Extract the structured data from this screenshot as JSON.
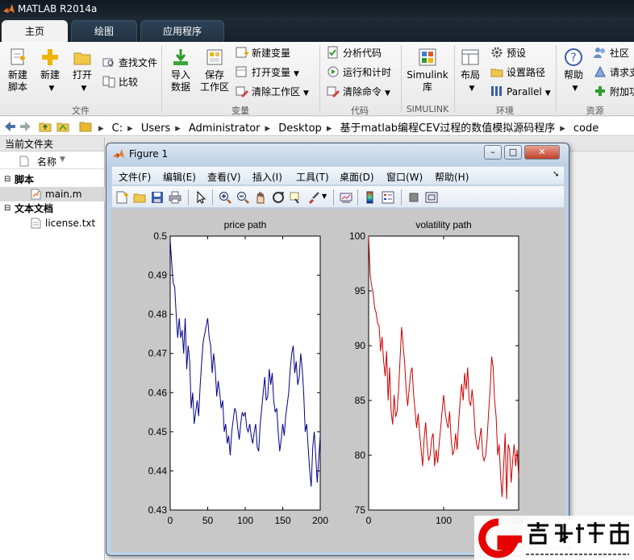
{
  "app": {
    "title": "MATLAB R2014a"
  },
  "tabs": [
    {
      "label": "主页"
    },
    {
      "label": "绘图"
    },
    {
      "label": "应用程序"
    }
  ],
  "ribbon": {
    "file": {
      "new_script": "新建\n脚本",
      "new": "新建",
      "open": "打开",
      "find_files": "查找文件",
      "compare": "比较",
      "group": "文件"
    },
    "variable": {
      "import_data": "导入\n数据",
      "save_workspace": "保存\n工作区",
      "new_variable": "新建变量",
      "open_variable": "打开变量",
      "clear_workspace": "清除工作区",
      "group": "变量"
    },
    "code": {
      "analyze_code": "分析代码",
      "run_and_time": "运行和计时",
      "clear_commands": "清除命令",
      "group": "代码"
    },
    "simulink": {
      "library": "Simulink\n库",
      "group": "SIMULINK"
    },
    "environment": {
      "layout": "布局",
      "preferences": "预设",
      "set_path": "设置路径",
      "parallel": "Parallel",
      "group": "环境"
    },
    "resources": {
      "help": "帮助",
      "community": "社区",
      "request_support": "请求支",
      "addons": "附加功",
      "group": "资源"
    }
  },
  "address": {
    "crumbs": [
      "C:",
      "Users",
      "Administrator",
      "Desktop",
      "基于matlab编程CEV过程的数值模拟源码程序",
      "code"
    ]
  },
  "file_panel": {
    "title": "当前文件夹",
    "col_name": "名称",
    "groups": [
      {
        "label": "脚本",
        "files": [
          "main.m"
        ]
      },
      {
        "label": "文本文档",
        "files": [
          "license.txt"
        ]
      }
    ]
  },
  "figure": {
    "title": "Figure 1",
    "menu": [
      "文件(F)",
      "编辑(E)",
      "查看(V)",
      "插入(I)",
      "工具(T)",
      "桌面(D)",
      "窗口(W)",
      "帮助(H)"
    ]
  },
  "chart_data": [
    {
      "type": "line",
      "title": "price path",
      "xlabel": "",
      "ylabel": "",
      "xlim": [
        0,
        200
      ],
      "ylim": [
        0.43,
        0.5
      ],
      "xticks": [
        0,
        50,
        100,
        150,
        200
      ],
      "yticks": [
        0.43,
        0.44,
        0.45,
        0.46,
        0.47,
        0.48,
        0.49,
        0.5
      ],
      "series": [
        {
          "color": "#00008b",
          "x": [
            0,
            2,
            4,
            6,
            8,
            10,
            12,
            14,
            16,
            18,
            20,
            22,
            24,
            26,
            28,
            30,
            32,
            34,
            36,
            38,
            40,
            42,
            44,
            46,
            48,
            50,
            52,
            54,
            56,
            58,
            60,
            62,
            64,
            66,
            68,
            70,
            72,
            74,
            76,
            78,
            80,
            82,
            84,
            86,
            88,
            90,
            92,
            94,
            96,
            98,
            100,
            102,
            104,
            106,
            108,
            110,
            112,
            114,
            116,
            118,
            120,
            122,
            124,
            126,
            128,
            130,
            132,
            134,
            136,
            138,
            140,
            142,
            144,
            146,
            148,
            150,
            152,
            154,
            156,
            158,
            160,
            162,
            164,
            166,
            168,
            170,
            172,
            174,
            176,
            178,
            180,
            182,
            184,
            186,
            188,
            190,
            192,
            194,
            196,
            198,
            200
          ],
          "y": [
            0.499,
            0.493,
            0.488,
            0.487,
            0.48,
            0.474,
            0.479,
            0.474,
            0.476,
            0.47,
            0.479,
            0.466,
            0.472,
            0.468,
            0.456,
            0.46,
            0.452,
            0.455,
            0.458,
            0.454,
            0.462,
            0.468,
            0.473,
            0.475,
            0.477,
            0.479,
            0.474,
            0.472,
            0.465,
            0.47,
            0.466,
            0.459,
            0.463,
            0.46,
            0.456,
            0.458,
            0.45,
            0.452,
            0.447,
            0.449,
            0.444,
            0.45,
            0.453,
            0.456,
            0.455,
            0.451,
            0.448,
            0.452,
            0.455,
            0.454,
            0.455,
            0.451,
            0.45,
            0.452,
            0.449,
            0.447,
            0.45,
            0.452,
            0.446,
            0.445,
            0.452,
            0.456,
            0.46,
            0.464,
            0.458,
            0.459,
            0.466,
            0.462,
            0.465,
            0.458,
            0.455,
            0.456,
            0.45,
            0.445,
            0.448,
            0.452,
            0.449,
            0.454,
            0.457,
            0.46,
            0.466,
            0.47,
            0.472,
            0.465,
            0.468,
            0.462,
            0.464,
            0.47,
            0.466,
            0.46,
            0.45,
            0.452,
            0.446,
            0.44,
            0.436,
            0.446,
            0.45,
            0.444,
            0.437,
            0.443,
            0.449
          ]
        }
      ]
    },
    {
      "type": "line",
      "title": "volatility path",
      "xlabel": "",
      "ylabel": "",
      "xlim": [
        0,
        200
      ],
      "ylim": [
        75,
        100
      ],
      "xticks": [
        0,
        100,
        200
      ],
      "yticks": [
        75,
        80,
        85,
        90,
        95,
        100
      ],
      "series": [
        {
          "color": "#cc0000",
          "x": [
            0,
            2,
            4,
            6,
            8,
            10,
            12,
            14,
            16,
            18,
            20,
            22,
            24,
            26,
            28,
            30,
            32,
            34,
            36,
            38,
            40,
            42,
            44,
            46,
            48,
            50,
            52,
            54,
            56,
            58,
            60,
            62,
            64,
            66,
            68,
            70,
            72,
            74,
            76,
            78,
            80,
            82,
            84,
            86,
            88,
            90,
            92,
            94,
            96,
            98,
            100,
            102,
            104,
            106,
            108,
            110,
            112,
            114,
            116,
            118,
            120,
            122,
            124,
            126,
            128,
            130,
            132,
            134,
            136,
            138,
            140,
            142,
            144,
            146,
            148,
            150,
            152,
            154,
            156,
            158,
            160,
            162,
            164,
            166,
            168,
            170,
            172,
            174,
            176,
            178,
            180,
            182,
            184,
            186,
            188,
            190,
            192,
            194,
            196,
            198,
            200
          ],
          "y": [
            100,
            96.5,
            95.5,
            94.8,
            93.5,
            93,
            92,
            91.8,
            89.5,
            90.8,
            88.6,
            87.2,
            89.5,
            85,
            88,
            84,
            82.8,
            85.5,
            83.5,
            84,
            86,
            89,
            91.7,
            90,
            88.5,
            86,
            84.5,
            86,
            87.5,
            88,
            85.5,
            84,
            82.5,
            83.8,
            82,
            80.5,
            79,
            81.5,
            83,
            81,
            79.5,
            80,
            81.5,
            82,
            79,
            80.5,
            79.3,
            81,
            82.5,
            84,
            85.5,
            84,
            83,
            82.5,
            84,
            81.5,
            80,
            80.5,
            82,
            80.5,
            83,
            85,
            86.5,
            85,
            87.5,
            86,
            88,
            85,
            84.5,
            86,
            84.5,
            82,
            81,
            80.5,
            81.5,
            82.5,
            80,
            79.5,
            80,
            81.5,
            84,
            86,
            89,
            88,
            85,
            83.5,
            80,
            81,
            78,
            76.2,
            79,
            82,
            76,
            81,
            80.5,
            77.5,
            79.5,
            81,
            79,
            80.5,
            78
          ]
        }
      ]
    }
  ]
}
